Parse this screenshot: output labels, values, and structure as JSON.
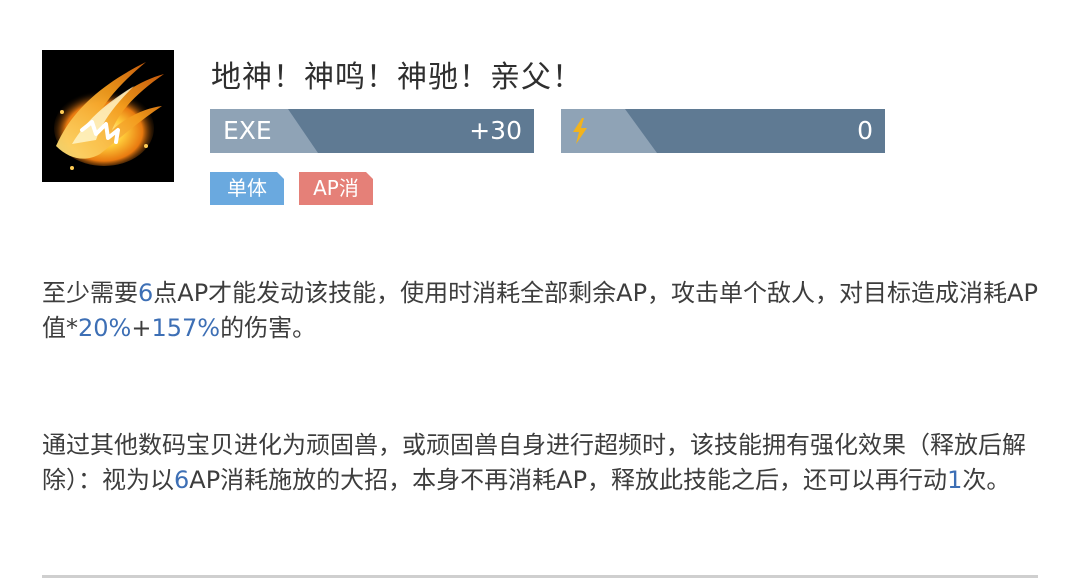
{
  "skill": {
    "title": "地神！神鸣！神驰！亲父！",
    "icon": "flame-slash-icon",
    "exe": {
      "label": "EXE",
      "value": "+30"
    },
    "ap": {
      "icon": "lightning-bolt-icon",
      "value": "0"
    },
    "tags": [
      "单体",
      "AP消"
    ],
    "description1": [
      {
        "text": "至少需要",
        "hl": false
      },
      {
        "text": "6",
        "hl": true
      },
      {
        "text": "点AP才能发动该技能，使用时消耗全部剩余AP，攻击单个敌人，对目标造成消耗AP值*",
        "hl": false
      },
      {
        "text": "20%",
        "hl": true
      },
      {
        "text": "+",
        "hl": false
      },
      {
        "text": "157%",
        "hl": true
      },
      {
        "text": "的伤害。",
        "hl": false
      }
    ],
    "description2": [
      {
        "text": "通过其他数码宝贝进化为顽固兽，或顽固兽自身进行超频时，该技能拥有强化效果（释放后解除）：视为以",
        "hl": false
      },
      {
        "text": "6",
        "hl": true
      },
      {
        "text": "AP消耗施放的大招，本身不再消耗AP，释放此技能之后，还可以再行动",
        "hl": false
      },
      {
        "text": "1",
        "hl": true
      },
      {
        "text": "次。",
        "hl": false
      }
    ]
  },
  "colors": {
    "bar_dark": "#5f7a93",
    "bar_light": "#8fa3b6",
    "tag_single": "#6aa9df",
    "tag_ap": "#e58078",
    "highlight": "#3d6fb5",
    "bolt": "#f2b31d"
  }
}
